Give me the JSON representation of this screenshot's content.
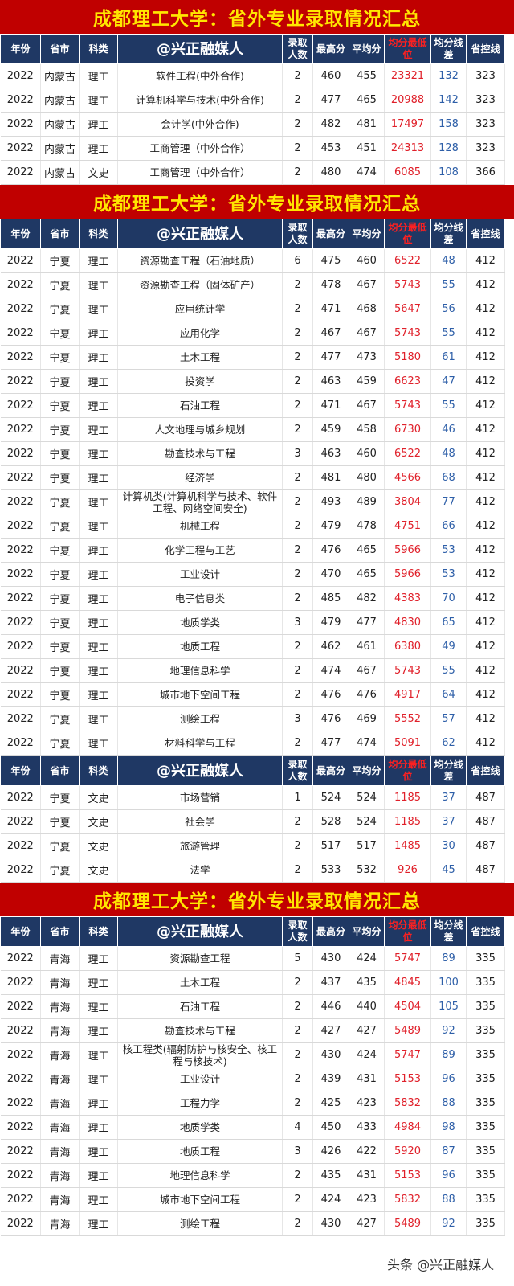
{
  "watermark": "头条 @兴正融媒人",
  "headers": [
    "年份",
    "省市",
    "科类",
    "@兴正融媒人",
    "录取人数",
    "最高分",
    "平均分",
    "均分最低位",
    "均分线差",
    "省控线"
  ],
  "sections": [
    {
      "banner": "成都理工大学：省外专业录取情况汇总",
      "rows": [
        [
          "2022",
          "内蒙古",
          "理工",
          "软件工程(中外合作)",
          "2",
          "460",
          "455",
          "23321",
          "132",
          "323"
        ],
        [
          "2022",
          "内蒙古",
          "理工",
          "计算机科学与技术(中外合作)",
          "2",
          "477",
          "465",
          "20988",
          "142",
          "323"
        ],
        [
          "2022",
          "内蒙古",
          "理工",
          "会计学(中外合作)",
          "2",
          "482",
          "481",
          "17497",
          "158",
          "323"
        ],
        [
          "2022",
          "内蒙古",
          "理工",
          "工商管理（中外合作）",
          "2",
          "453",
          "451",
          "24313",
          "128",
          "323"
        ],
        [
          "2022",
          "内蒙古",
          "文史",
          "工商管理（中外合作）",
          "2",
          "480",
          "474",
          "6085",
          "108",
          "366"
        ]
      ]
    },
    {
      "banner": "成都理工大学：省外专业录取情况汇总",
      "rows": [
        [
          "2022",
          "宁夏",
          "理工",
          "资源勘查工程（石油地质）",
          "6",
          "475",
          "460",
          "6522",
          "48",
          "412"
        ],
        [
          "2022",
          "宁夏",
          "理工",
          "资源勘查工程（固体矿产）",
          "2",
          "478",
          "467",
          "5743",
          "55",
          "412"
        ],
        [
          "2022",
          "宁夏",
          "理工",
          "应用统计学",
          "2",
          "471",
          "468",
          "5647",
          "56",
          "412"
        ],
        [
          "2022",
          "宁夏",
          "理工",
          "应用化学",
          "2",
          "467",
          "467",
          "5743",
          "55",
          "412"
        ],
        [
          "2022",
          "宁夏",
          "理工",
          "土木工程",
          "2",
          "477",
          "473",
          "5180",
          "61",
          "412"
        ],
        [
          "2022",
          "宁夏",
          "理工",
          "投资学",
          "2",
          "463",
          "459",
          "6623",
          "47",
          "412"
        ],
        [
          "2022",
          "宁夏",
          "理工",
          "石油工程",
          "2",
          "471",
          "467",
          "5743",
          "55",
          "412"
        ],
        [
          "2022",
          "宁夏",
          "理工",
          "人文地理与城乡规划",
          "2",
          "459",
          "458",
          "6730",
          "46",
          "412"
        ],
        [
          "2022",
          "宁夏",
          "理工",
          "勘查技术与工程",
          "3",
          "463",
          "460",
          "6522",
          "48",
          "412"
        ],
        [
          "2022",
          "宁夏",
          "理工",
          "经济学",
          "2",
          "481",
          "480",
          "4566",
          "68",
          "412"
        ],
        [
          "2022",
          "宁夏",
          "理工",
          "计算机类(计算机科学与技术、软件工程、网络空间安全)",
          "2",
          "493",
          "489",
          "3804",
          "77",
          "412"
        ],
        [
          "2022",
          "宁夏",
          "理工",
          "机械工程",
          "2",
          "479",
          "478",
          "4751",
          "66",
          "412"
        ],
        [
          "2022",
          "宁夏",
          "理工",
          "化学工程与工艺",
          "2",
          "476",
          "465",
          "5966",
          "53",
          "412"
        ],
        [
          "2022",
          "宁夏",
          "理工",
          "工业设计",
          "2",
          "470",
          "465",
          "5966",
          "53",
          "412"
        ],
        [
          "2022",
          "宁夏",
          "理工",
          "电子信息类",
          "2",
          "485",
          "482",
          "4383",
          "70",
          "412"
        ],
        [
          "2022",
          "宁夏",
          "理工",
          "地质学类",
          "3",
          "479",
          "477",
          "4830",
          "65",
          "412"
        ],
        [
          "2022",
          "宁夏",
          "理工",
          "地质工程",
          "2",
          "462",
          "461",
          "6380",
          "49",
          "412"
        ],
        [
          "2022",
          "宁夏",
          "理工",
          "地理信息科学",
          "2",
          "474",
          "467",
          "5743",
          "55",
          "412"
        ],
        [
          "2022",
          "宁夏",
          "理工",
          "城市地下空间工程",
          "2",
          "476",
          "476",
          "4917",
          "64",
          "412"
        ],
        [
          "2022",
          "宁夏",
          "理工",
          "测绘工程",
          "3",
          "476",
          "469",
          "5552",
          "57",
          "412"
        ],
        [
          "2022",
          "宁夏",
          "理工",
          "材料科学与工程",
          "2",
          "477",
          "474",
          "5091",
          "62",
          "412"
        ]
      ]
    },
    {
      "banner": "",
      "rows": [
        [
          "2022",
          "宁夏",
          "文史",
          "市场营销",
          "1",
          "524",
          "524",
          "1185",
          "37",
          "487"
        ],
        [
          "2022",
          "宁夏",
          "文史",
          "社会学",
          "2",
          "528",
          "524",
          "1185",
          "37",
          "487"
        ],
        [
          "2022",
          "宁夏",
          "文史",
          "旅游管理",
          "2",
          "517",
          "517",
          "1485",
          "30",
          "487"
        ],
        [
          "2022",
          "宁夏",
          "文史",
          "法学",
          "2",
          "533",
          "532",
          "926",
          "45",
          "487"
        ]
      ]
    },
    {
      "banner": "成都理工大学：省外专业录取情况汇总",
      "rows": [
        [
          "2022",
          "青海",
          "理工",
          "资源勘查工程",
          "5",
          "430",
          "424",
          "5747",
          "89",
          "335"
        ],
        [
          "2022",
          "青海",
          "理工",
          "土木工程",
          "2",
          "437",
          "435",
          "4845",
          "100",
          "335"
        ],
        [
          "2022",
          "青海",
          "理工",
          "石油工程",
          "2",
          "446",
          "440",
          "4504",
          "105",
          "335"
        ],
        [
          "2022",
          "青海",
          "理工",
          "勘查技术与工程",
          "2",
          "427",
          "427",
          "5489",
          "92",
          "335"
        ],
        [
          "2022",
          "青海",
          "理工",
          "核工程类(辐射防护与核安全、核工程与核技术)",
          "2",
          "430",
          "424",
          "5747",
          "89",
          "335"
        ],
        [
          "2022",
          "青海",
          "理工",
          "工业设计",
          "2",
          "439",
          "431",
          "5153",
          "96",
          "335"
        ],
        [
          "2022",
          "青海",
          "理工",
          "工程力学",
          "2",
          "425",
          "423",
          "5832",
          "88",
          "335"
        ],
        [
          "2022",
          "青海",
          "理工",
          "地质学类",
          "4",
          "450",
          "433",
          "4984",
          "98",
          "335"
        ],
        [
          "2022",
          "青海",
          "理工",
          "地质工程",
          "3",
          "426",
          "422",
          "5920",
          "87",
          "335"
        ],
        [
          "2022",
          "青海",
          "理工",
          "地理信息科学",
          "2",
          "435",
          "431",
          "5153",
          "96",
          "335"
        ],
        [
          "2022",
          "青海",
          "理工",
          "城市地下空间工程",
          "2",
          "424",
          "423",
          "5832",
          "88",
          "335"
        ],
        [
          "2022",
          "青海",
          "理工",
          "测绘工程",
          "2",
          "430",
          "427",
          "5489",
          "92",
          "335"
        ]
      ]
    }
  ]
}
